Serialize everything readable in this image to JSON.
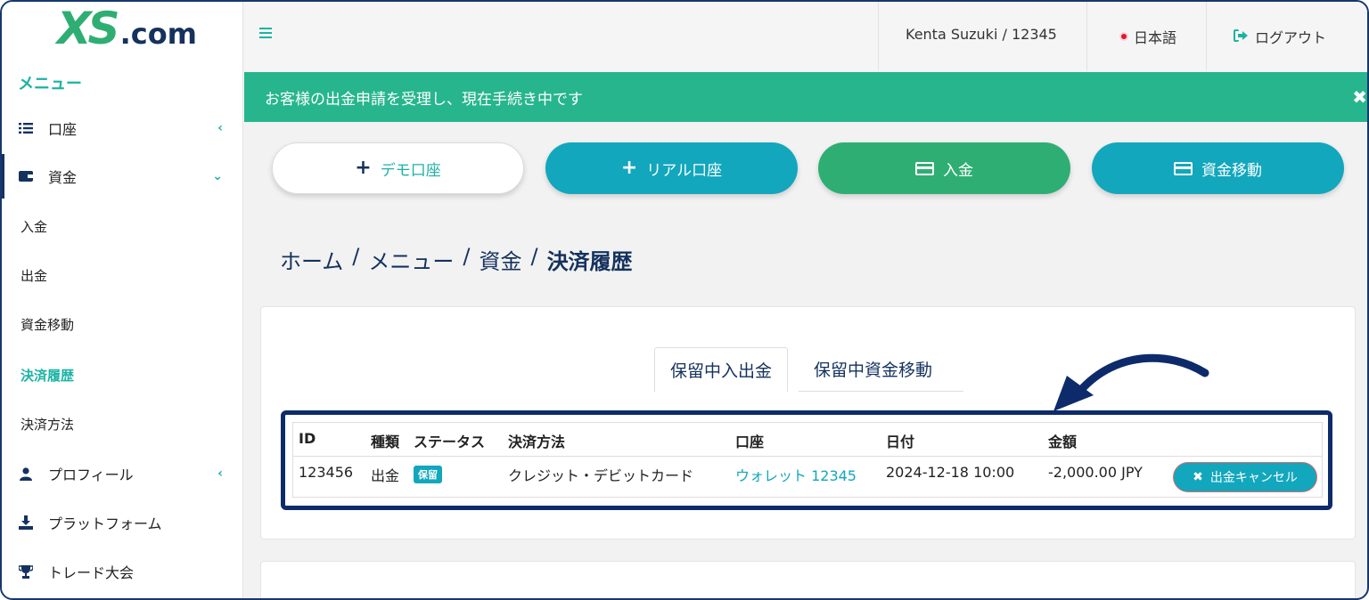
{
  "logo": {
    "xs": "XS",
    "com": ".com"
  },
  "sidebar": {
    "heading": "メニュー",
    "items": [
      {
        "label": "口座",
        "icon": "list-icon"
      },
      {
        "label": "資金",
        "icon": "wallet-icon"
      },
      {
        "label": "入金"
      },
      {
        "label": "出金"
      },
      {
        "label": "資金移動"
      },
      {
        "label": "決済履歴"
      },
      {
        "label": "決済方法"
      },
      {
        "label": "プロフィール",
        "icon": "user-icon"
      },
      {
        "label": "プラットフォーム",
        "icon": "download-icon"
      },
      {
        "label": "トレード大会",
        "icon": "trophy-icon"
      }
    ]
  },
  "topbar": {
    "user": "Kenta Suzuki / 12345",
    "language": "日本語",
    "logout": "ログアウト"
  },
  "alert": {
    "message": "お客様の出金申請を受理し、現在手続き中です"
  },
  "actions": {
    "demo": "デモ口座",
    "real": "リアル口座",
    "deposit": "入金",
    "transfer": "資金移動"
  },
  "breadcrumb": [
    "ホーム",
    "/",
    "メニュー",
    "/",
    "資金",
    "/",
    "決済履歴"
  ],
  "tabs": [
    "保留中入出金",
    "保留中資金移動"
  ],
  "table": {
    "headers": [
      "ID",
      "種類",
      "ステータス",
      "決済方法",
      "口座",
      "日付",
      "金額"
    ],
    "row": {
      "id": "123456",
      "type": "出金",
      "status": "保留",
      "method": "クレジット・デビットカード",
      "account": "ウォレット 12345",
      "date": "2024-12-18 10:00",
      "amount": "-2,000.00 JPY",
      "action": "出金キャンセル"
    }
  },
  "colors": {
    "accent": "#1bb3a4",
    "brand_green": "#2fae73",
    "navy": "#15325e",
    "alert": "#27b58d"
  }
}
